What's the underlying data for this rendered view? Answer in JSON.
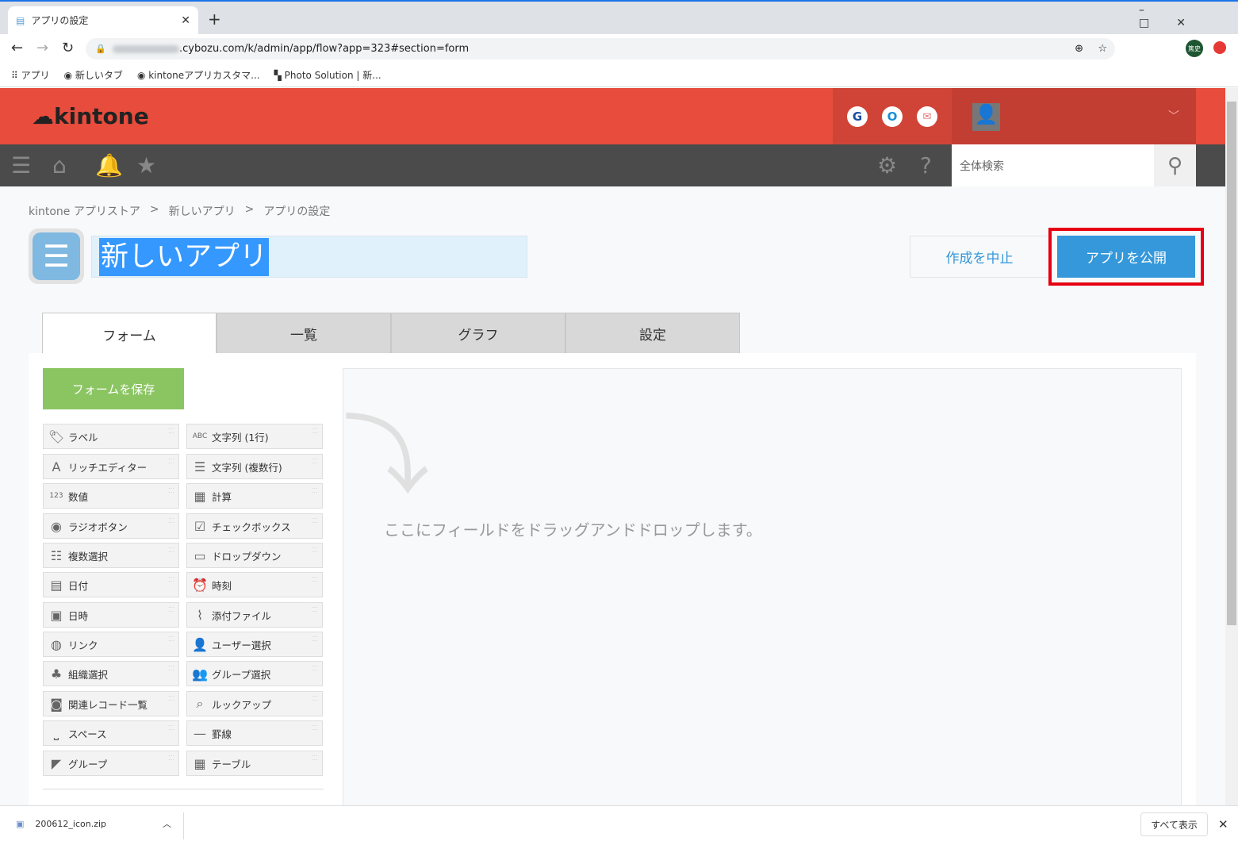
{
  "browser": {
    "tab_title": "アプリの設定",
    "url": ".cybozu.com/k/admin/app/flow?app=323#section=form",
    "bookmarks": [
      "アプリ",
      "新しいタブ",
      "kintoneアプリカスタマ...",
      "Photo Solution | 新..."
    ],
    "profile": "篤史"
  },
  "header": {
    "logo": "kintone",
    "search_placeholder": "全体検索",
    "brand_color": "#e74c3c"
  },
  "breadcrumb": [
    "kintone アプリストア",
    ">",
    "新しいアプリ",
    ">",
    "アプリの設定"
  ],
  "app": {
    "name": "新しいアプリ",
    "cancel_label": "作成を中止",
    "publish_label": "アプリを公開"
  },
  "tabs": [
    "フォーム",
    "一覧",
    "グラフ",
    "設定"
  ],
  "form": {
    "save_label": "フォームを保存",
    "drop_hint": "ここにフィールドをドラッグアンドドロップします。",
    "fields_left": [
      {
        "label": "ラベル",
        "icon": "tag-icon"
      },
      {
        "label": "リッチエディター",
        "icon": "rich-editor-icon"
      },
      {
        "label": "数値",
        "icon": "number-icon"
      },
      {
        "label": "ラジオボタン",
        "icon": "radio-icon"
      },
      {
        "label": "複数選択",
        "icon": "multi-select-icon"
      },
      {
        "label": "日付",
        "icon": "calendar-icon"
      },
      {
        "label": "日時",
        "icon": "datetime-icon"
      },
      {
        "label": "リンク",
        "icon": "globe-icon"
      },
      {
        "label": "組織選択",
        "icon": "org-icon"
      },
      {
        "label": "関連レコード一覧",
        "icon": "related-records-icon"
      },
      {
        "label": "スペース",
        "icon": "space-icon"
      },
      {
        "label": "グループ",
        "icon": "group-icon"
      }
    ],
    "fields_right": [
      {
        "label": "文字列 (1行)",
        "icon": "abc-icon"
      },
      {
        "label": "文字列 (複数行)",
        "icon": "multiline-icon"
      },
      {
        "label": "計算",
        "icon": "calculator-icon"
      },
      {
        "label": "チェックボックス",
        "icon": "checkbox-icon"
      },
      {
        "label": "ドロップダウン",
        "icon": "dropdown-icon"
      },
      {
        "label": "時刻",
        "icon": "clock-icon"
      },
      {
        "label": "添付ファイル",
        "icon": "paperclip-icon"
      },
      {
        "label": "ユーザー選択",
        "icon": "user-icon"
      },
      {
        "label": "グループ選択",
        "icon": "users-icon"
      },
      {
        "label": "ルックアップ",
        "icon": "lookup-icon"
      },
      {
        "label": "罫線",
        "icon": "line-icon"
      },
      {
        "label": "テーブル",
        "icon": "table-icon"
      }
    ]
  },
  "download": {
    "file": "200612_icon.zip",
    "show_all": "すべて表示"
  }
}
